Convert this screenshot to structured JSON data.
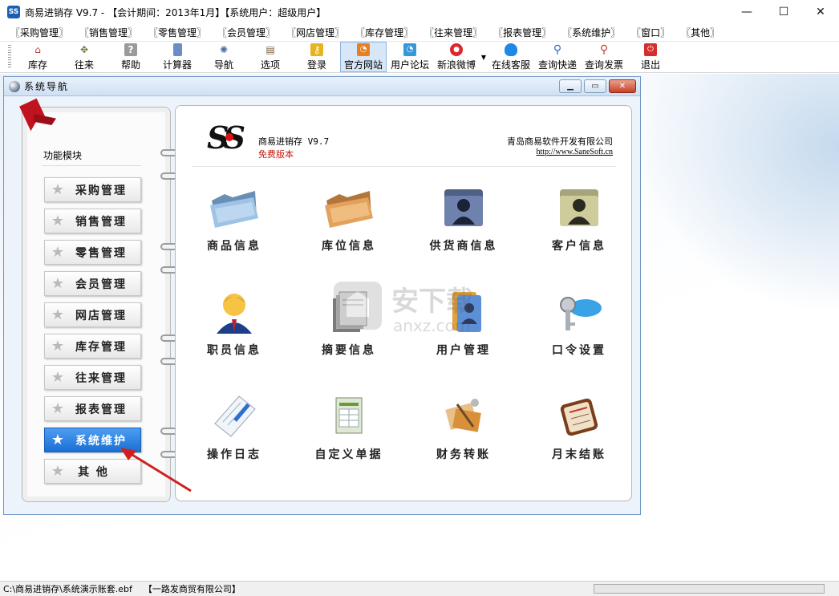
{
  "window": {
    "title": "商易进销存 V9.7 - 【会计期间：2013年1月】【系统用户：超级用户】",
    "app_icon": "SS",
    "controls": [
      "—",
      "☐",
      "✕"
    ]
  },
  "menu": [
    "〖采购管理〗",
    "〖销售管理〗",
    "〖零售管理〗",
    "〖会员管理〗",
    "〖网店管理〗",
    "〖库存管理〗",
    "〖往来管理〗",
    "〖报表管理〗",
    "〖系统维护〗",
    "〖窗口〗",
    "〖其他〗"
  ],
  "toolbar": [
    {
      "label": "库存",
      "icon": "home-icon",
      "color": "#c0392b"
    },
    {
      "label": "往来",
      "icon": "handshake-icon",
      "color": "#6b7b3a"
    },
    {
      "label": "帮助",
      "icon": "help-icon",
      "color": "#8a8a8a"
    },
    {
      "label": "计算器",
      "icon": "calculator-icon",
      "color": "#5b7db0"
    },
    {
      "label": "导航",
      "icon": "navigation-icon",
      "color": "#4a6fa5"
    },
    {
      "label": "选项",
      "icon": "options-icon",
      "color": "#7a5a3a"
    },
    {
      "label": "登录",
      "icon": "key-icon",
      "color": "#d9a400"
    },
    {
      "label": "官方网站",
      "icon": "rss-icon",
      "color": "#e67e22"
    },
    {
      "label": "用户论坛",
      "icon": "rss-icon",
      "color": "#3498db"
    },
    {
      "label": "新浪微博",
      "icon": "weibo-icon",
      "color": "#e0242b"
    },
    {
      "label": "在线客服",
      "icon": "qq-icon",
      "color": "#1e88e5"
    },
    {
      "label": "查询快递",
      "icon": "search-icon",
      "color": "#2c6fb7"
    },
    {
      "label": "查询发票",
      "icon": "search-icon",
      "color": "#c0392b"
    },
    {
      "label": "退出",
      "icon": "exit-icon",
      "color": "#d32f2f"
    }
  ],
  "nav_window": {
    "title": "系统导航",
    "function_label": "功能模块",
    "modules": [
      "采购管理",
      "销售管理",
      "零售管理",
      "会员管理",
      "网店管理",
      "库存管理",
      "往来管理",
      "报表管理",
      "系统维护",
      "其 他"
    ],
    "active_module": "系统维护",
    "product": "商易进销存 V9.7",
    "edition": "免费版本",
    "company": "青岛商易软件开发有限公司",
    "url": "http://www.SaneSoft.cn",
    "tiles": [
      {
        "label": "商品信息",
        "icon": "folder-blue-icon"
      },
      {
        "label": "库位信息",
        "icon": "folder-orange-icon"
      },
      {
        "label": "供货商信息",
        "icon": "folder-user-dark-icon"
      },
      {
        "label": "客户信息",
        "icon": "folder-user-light-icon"
      },
      {
        "label": "职员信息",
        "icon": "person-icon"
      },
      {
        "label": "摘要信息",
        "icon": "document-stack-icon"
      },
      {
        "label": "用户管理",
        "icon": "user-folders-icon"
      },
      {
        "label": "口令设置",
        "icon": "key-tag-icon"
      },
      {
        "label": "操作日志",
        "icon": "notepad-pen-icon"
      },
      {
        "label": "自定义单据",
        "icon": "form-icon"
      },
      {
        "label": "财务转账",
        "icon": "transfer-icon"
      },
      {
        "label": "月末结账",
        "icon": "month-close-icon"
      }
    ]
  },
  "watermark": "安下载 anxz.com",
  "status": {
    "path": "C:\\商易进销存\\系统演示账套.ebf",
    "company": "【一路发商贸有限公司】"
  }
}
